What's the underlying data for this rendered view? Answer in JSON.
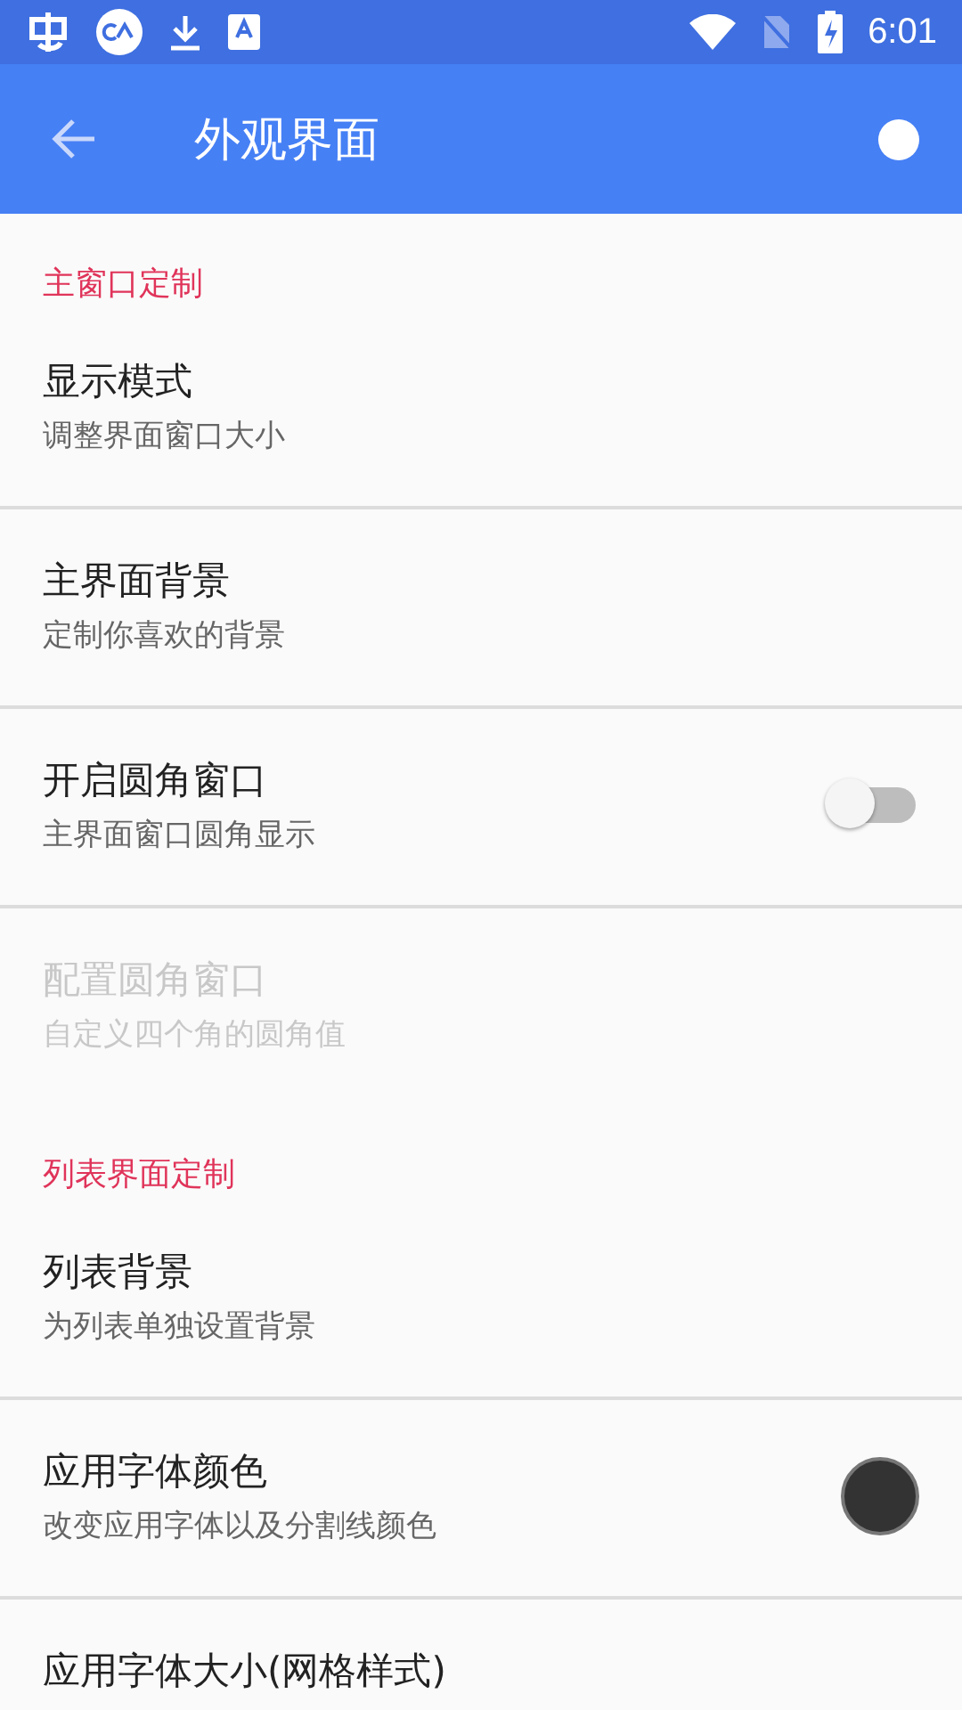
{
  "status_bar": {
    "time": "6:01"
  },
  "toolbar": {
    "title": "外观界面"
  },
  "sections": [
    {
      "header": "主窗口定制",
      "items": [
        {
          "kind": "plain",
          "title": "显示模式",
          "subtitle": "调整界面窗口大小",
          "disabled": false
        },
        {
          "kind": "plain",
          "title": "主界面背景",
          "subtitle": "定制你喜欢的背景",
          "disabled": false
        },
        {
          "kind": "switch",
          "title": "开启圆角窗口",
          "subtitle": "主界面窗口圆角显示",
          "disabled": false,
          "on": false
        },
        {
          "kind": "plain",
          "title": "配置圆角窗口",
          "subtitle": "自定义四个角的圆角值",
          "disabled": true
        }
      ]
    },
    {
      "header": "列表界面定制",
      "items": [
        {
          "kind": "plain",
          "title": "列表背景",
          "subtitle": "为列表单独设置背景",
          "disabled": false
        },
        {
          "kind": "color",
          "title": "应用字体颜色",
          "subtitle": "改变应用字体以及分割线颜色",
          "disabled": false,
          "color": "#333333"
        },
        {
          "kind": "plain",
          "title": "应用字体大小(网格样式)",
          "disabled": false
        }
      ]
    }
  ]
}
